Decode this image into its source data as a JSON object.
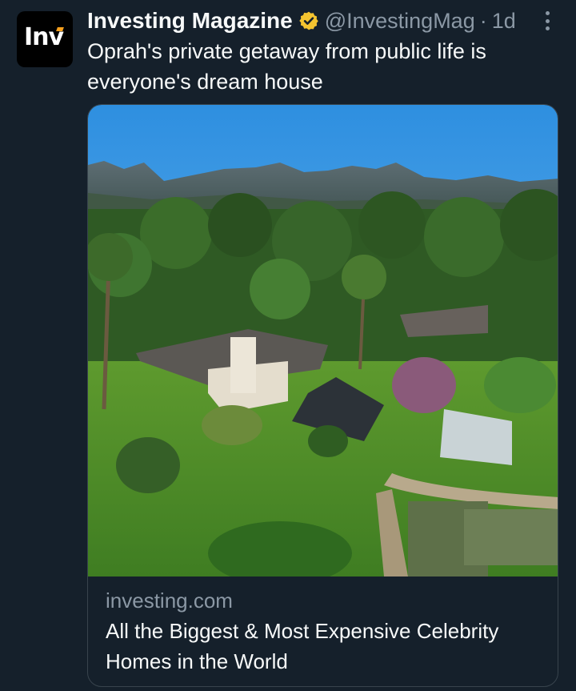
{
  "tweet": {
    "author_name": "Investing Magazine",
    "handle": "@InvestingMag",
    "separator": "·",
    "time": "1d",
    "text": "Oprah's private getaway from public life is everyone's dream house",
    "avatar_logo_text": "Inv",
    "verified_icon": "verified-badge-icon",
    "verified_color": "#f4c430"
  },
  "card": {
    "domain": "investing.com",
    "title": "All the Biggest & Most Expensive Celebrity Homes in the World",
    "image_subject": "aerial-view-estate-photo"
  },
  "colors": {
    "background": "#15202b",
    "text_primary": "#f7f9f9",
    "text_secondary": "#8b98a5",
    "border": "#38444d"
  }
}
